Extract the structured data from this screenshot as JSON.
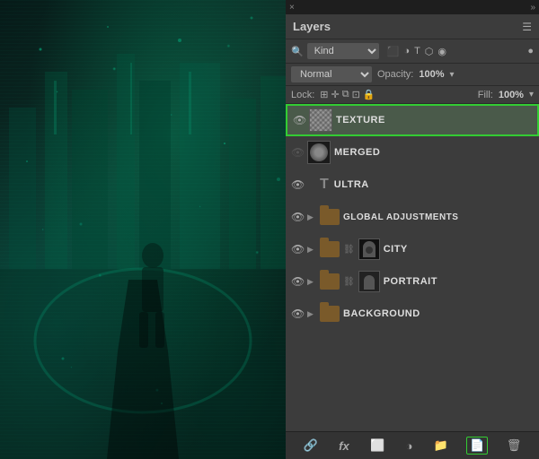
{
  "panel": {
    "title": "Layers",
    "close_label": "×",
    "expand_label": "»"
  },
  "filter": {
    "kind_label": "Kind",
    "kind_placeholder": "Kind",
    "icons": [
      "image-icon",
      "circle-icon",
      "T-icon",
      "path-icon",
      "circle-outline-icon"
    ]
  },
  "blend": {
    "mode_label": "Normal",
    "opacity_label": "Opacity:",
    "opacity_value": "100%",
    "opacity_dropdown": "▾"
  },
  "lock": {
    "label": "Lock:",
    "icons": [
      "grid-icon",
      "move-icon",
      "brush-icon",
      "position-icon",
      "lock-icon"
    ],
    "fill_label": "Fill:",
    "fill_value": "100%",
    "fill_dropdown": "▾"
  },
  "layers": [
    {
      "id": "texture",
      "name": "TEXTURE",
      "visible": true,
      "active": true,
      "type": "image",
      "has_expand": false,
      "has_chain": false
    },
    {
      "id": "merged",
      "name": "MERGED",
      "visible": false,
      "active": false,
      "type": "merged",
      "has_expand": false,
      "has_chain": false
    },
    {
      "id": "ultra",
      "name": "ULTRA",
      "visible": true,
      "active": false,
      "type": "text",
      "has_expand": false,
      "has_chain": false
    },
    {
      "id": "global-adjustments",
      "name": "GLOBAL ADJUSTMENTS",
      "visible": true,
      "active": false,
      "type": "folder",
      "has_expand": true,
      "has_chain": false
    },
    {
      "id": "city",
      "name": "CITY",
      "visible": true,
      "active": false,
      "type": "folder-linked",
      "has_expand": true,
      "has_chain": true
    },
    {
      "id": "portrait",
      "name": "PORTRAIT",
      "visible": true,
      "active": false,
      "type": "folder-linked",
      "has_expand": true,
      "has_chain": true
    },
    {
      "id": "background",
      "name": "BACKGROUND",
      "visible": true,
      "active": false,
      "type": "folder",
      "has_expand": true,
      "has_chain": false
    }
  ],
  "toolbar": {
    "link_label": "🔗",
    "fx_label": "fx",
    "mask_label": "⬜",
    "adjustment_label": "◑",
    "folder_label": "📁",
    "new_layer_label": "📄",
    "delete_label": "🗑"
  }
}
